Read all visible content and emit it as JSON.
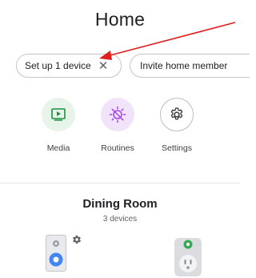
{
  "header": {
    "title": "Home"
  },
  "chips": {
    "setup": {
      "label": "Set up 1 device",
      "close_icon": "close-icon"
    },
    "invite": {
      "label": "Invite home member"
    }
  },
  "quick_actions": [
    {
      "label": "Media",
      "icon": "play-icon",
      "color": "#1e8e3e",
      "bg": "#e6f4ea"
    },
    {
      "label": "Routines",
      "icon": "routines-sun-icon",
      "color": "#a142f4",
      "bg": "#f1e4fa"
    },
    {
      "label": "Settings",
      "icon": "gear-icon",
      "color": "#3c4043",
      "bg": "#ffffff"
    }
  ],
  "room": {
    "name": "Dining Room",
    "device_count": "3 devices",
    "devices": [
      {
        "icon": "speaker-icon",
        "accent": "#4285f4"
      },
      {
        "icon": "smart-plug-icon",
        "accent": "#34a853"
      }
    ]
  },
  "annotation": {
    "color": "#e02020"
  }
}
